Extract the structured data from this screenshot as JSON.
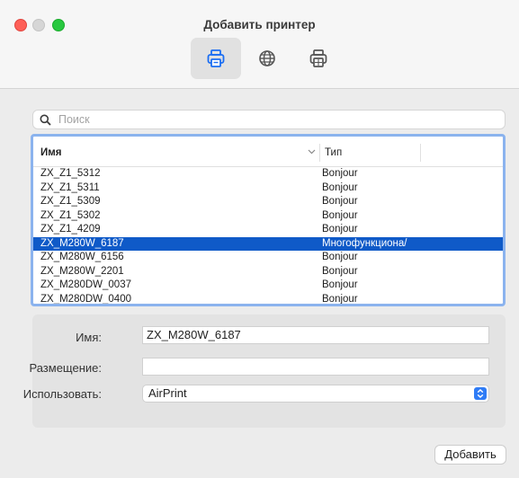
{
  "window": {
    "title": "Добавить принтер"
  },
  "toolbar": {
    "items": [
      {
        "icon": "printer-icon",
        "selected": true
      },
      {
        "icon": "globe-icon",
        "selected": false
      },
      {
        "icon": "windows-printer-icon",
        "selected": false
      }
    ]
  },
  "search": {
    "placeholder": "Поиск"
  },
  "table": {
    "columns": [
      "Имя",
      "Тип"
    ],
    "rows": [
      {
        "name": "ZX_Z1_5312",
        "type": "Bonjour"
      },
      {
        "name": "ZX_Z1_5311",
        "type": "Bonjour"
      },
      {
        "name": "ZX_Z1_5309",
        "type": "Bonjour"
      },
      {
        "name": "ZX_Z1_5302",
        "type": "Bonjour"
      },
      {
        "name": "ZX_Z1_4209",
        "type": "Bonjour"
      },
      {
        "name": "ZX_M280W_6187",
        "type": "Многофункциона/",
        "selected": true
      },
      {
        "name": "ZX_M280W_6156",
        "type": "Bonjour"
      },
      {
        "name": "ZX_M280W_2201",
        "type": "Bonjour"
      },
      {
        "name": "ZX_M280DW_0037",
        "type": "Bonjour"
      },
      {
        "name": "ZX_M280DW_0400",
        "type": "Bonjour"
      }
    ]
  },
  "form": {
    "name_label": "Имя:",
    "name_value": "ZX_M280W_6187",
    "location_label": "Размещение:",
    "location_value": "",
    "use_label": "Использовать:",
    "use_value": "AirPrint"
  },
  "add_button": "Добавить",
  "colors": {
    "accent": "#0f5ac8",
    "focus_ring": "#8bb3ee"
  }
}
